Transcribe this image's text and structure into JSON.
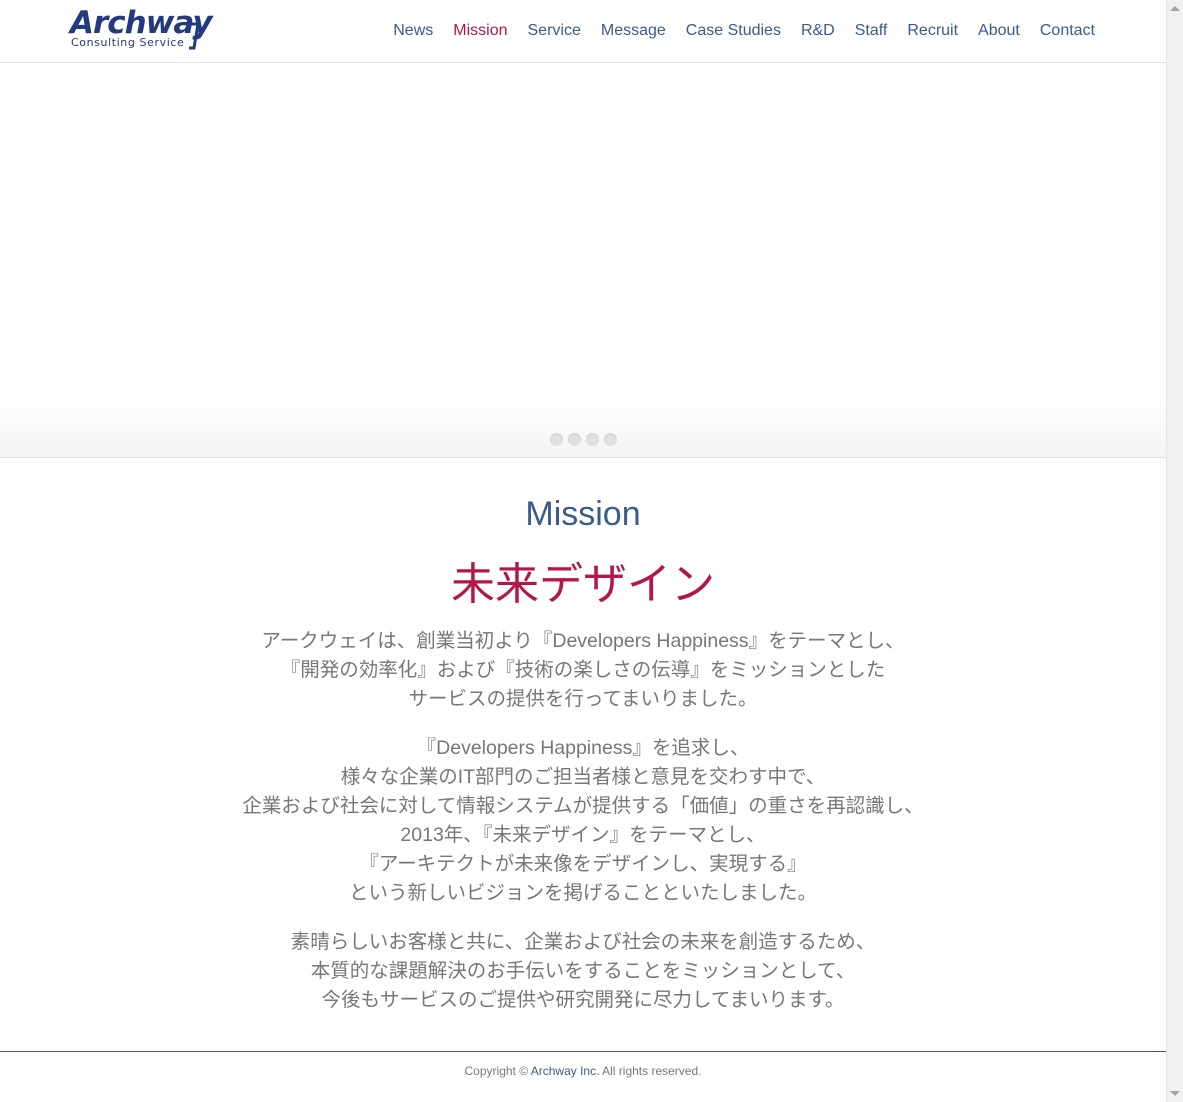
{
  "logo": {
    "main": "Archway",
    "sub": "Consulting Service"
  },
  "nav": {
    "items": [
      {
        "label": "News"
      },
      {
        "label": "Mission",
        "active": true
      },
      {
        "label": "Service"
      },
      {
        "label": "Message"
      },
      {
        "label": "Case Studies"
      },
      {
        "label": "R&D"
      },
      {
        "label": "Staff"
      },
      {
        "label": "Recruit"
      },
      {
        "label": "About"
      },
      {
        "label": "Contact"
      }
    ]
  },
  "slider": {
    "dot_count": 4
  },
  "mission": {
    "title": "Mission",
    "headline": "未来デザイン",
    "paragraphs": [
      [
        "アークウェイは、創業当初より『Developers Happiness』をテーマとし、",
        "『開発の効率化』および『技術の楽しさの伝導』をミッションとした",
        "サービスの提供を行ってまいりました。"
      ],
      [
        "『Developers Happiness』を追求し、",
        "様々な企業のIT部門のご担当者様と意見を交わす中で、",
        "企業および社会に対して情報システムが提供する「価値」の重さを再認識し、",
        "2013年、『未来デザイン』をテーマとし、",
        "『アーキテクトが未来像をデザインし、実現する』",
        "という新しいビジョンを掲げることといたしました。"
      ],
      [
        "素晴らしいお客様と共に、企業および社会の未来を創造するため、",
        "本質的な課題解決のお手伝いをすることをミッションとして、",
        "今後もサービスのご提供や研究開発に尽力してまいります。"
      ]
    ]
  },
  "footer": {
    "prefix": "Copyright © ",
    "company": "Archway Inc.",
    "suffix": " All rights reserved."
  },
  "colors": {
    "brand_blue": "#233a7e",
    "nav_text": "#3a5b8d",
    "accent_red": "#b5164a",
    "body_text": "#777777"
  }
}
